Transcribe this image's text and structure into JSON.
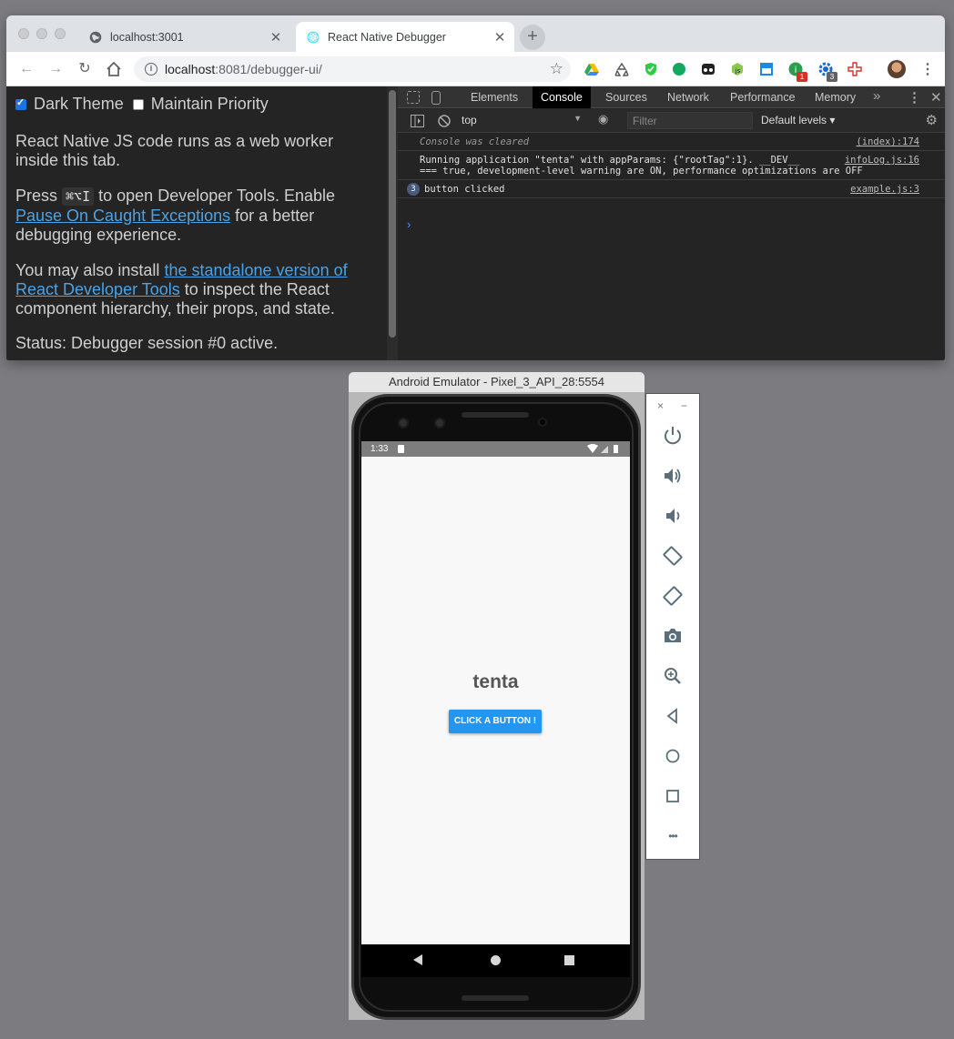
{
  "browser": {
    "tabs": [
      {
        "label": "localhost:3001",
        "active": false
      },
      {
        "label": "React Native Debugger",
        "active": true
      }
    ],
    "url_host": "localhost",
    "url_rest": ":8081/debugger-ui/",
    "extension_badges": [
      "1",
      "3"
    ]
  },
  "page": {
    "dark_theme_label": "Dark Theme",
    "maintain_priority_label": "Maintain Priority",
    "para1": "React Native JS code runs as a web worker inside this tab.",
    "para2_pre": "Press",
    "para2_kbd": "⌘⌥I",
    "para2_mid": "to open Developer Tools. Enable",
    "para2_link": "Pause On Caught Exceptions",
    "para2_post": "for a better debugging experience.",
    "para3_pre": "You may also install",
    "para3_link": "the standalone version of React Developer Tools",
    "para3_post": "to inspect the React component hierarchy, their props, and state.",
    "status": "Status: Debugger session #0 active."
  },
  "devtools": {
    "tabs": [
      "Elements",
      "Console",
      "Sources",
      "Network",
      "Performance",
      "Memory"
    ],
    "active_tab": "Console",
    "more": "»",
    "context": "top",
    "filter_placeholder": "Filter",
    "levels": "Default levels ▾",
    "logs": [
      {
        "msg": "Console was cleared",
        "src": "(index):174"
      },
      {
        "msg": "Running application \"tenta\" with appParams: {\"rootTag\":1}. __DEV__\n=== true, development-level warning are ON, performance optimizations are OFF",
        "src": "infoLog.js:16"
      },
      {
        "count": "3",
        "msg": "button clicked",
        "src": "example.js:3"
      }
    ],
    "prompt": "›"
  },
  "emulator": {
    "title": "Android Emulator - Pixel_3_API_28:5554",
    "time": "1:33",
    "app_title": "tenta",
    "button_label": "CLICK A BUTTON !",
    "panel_close": "×",
    "panel_minimize": "−",
    "panel_more": "•••"
  },
  "colors": {
    "accent_blue": "#2196f3",
    "link_blue": "#4aa3e8",
    "chrome_blue": "#1a73e8"
  }
}
